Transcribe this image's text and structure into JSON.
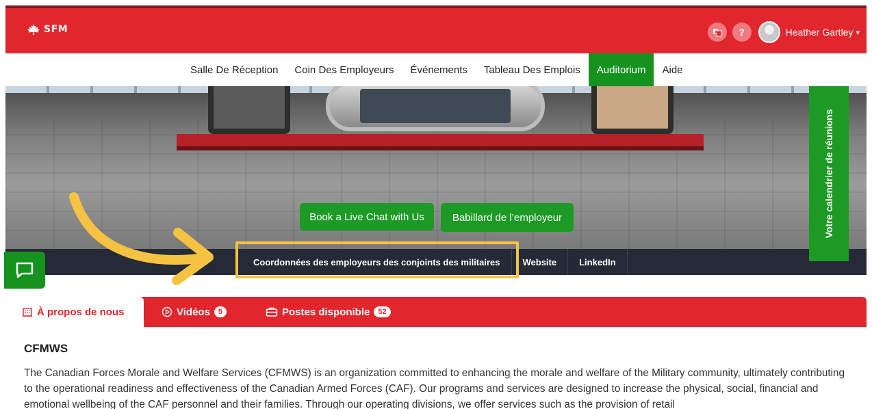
{
  "header": {
    "logo_text": "SFM",
    "translate_icon": "translate-icon",
    "help_label": "?",
    "user_name": "Heather Gartley",
    "caret": "▾",
    "brand_red": "#e1262d"
  },
  "nav": {
    "items": [
      {
        "label": "Salle De Réception"
      },
      {
        "label": "Coin Des Employeurs"
      },
      {
        "label": "Événements"
      },
      {
        "label": "Tableau Des Emplois"
      },
      {
        "label": "Auditorium",
        "active": true
      },
      {
        "label": "Aide"
      }
    ],
    "active_color": "#16921f"
  },
  "hero": {
    "book_chat_label": "Book a Live Chat with Us",
    "board_label": "Babillard de l’employeur",
    "calendar_label": "Votre calendrier de réunions"
  },
  "links_bar": {
    "items": [
      {
        "label": "Coordonnées des employeurs des conjoints des militaires"
      },
      {
        "label": "Website"
      },
      {
        "label": "LinkedIn"
      }
    ]
  },
  "annotation": {
    "highlight_color": "#f5c242"
  },
  "tabs": {
    "about": {
      "label": "À propos de nous",
      "icon": "building-icon"
    },
    "videos": {
      "label": "Vidéos",
      "count": "5",
      "icon": "play-circle-icon"
    },
    "jobs": {
      "label": "Postes disponible",
      "count": "52",
      "icon": "briefcase-icon"
    }
  },
  "content": {
    "title": "CFMWS",
    "body": "The Canadian Forces Morale and Welfare Services (CFMWS) is an organization committed to enhancing the morale and welfare of the Military community, ultimately contributing to the operational readiness and effectiveness of the Canadian Armed Forces (CAF). Our programs and services are designed to increase the physical, social, financial and emotional wellbeing of the CAF personnel and their families. Through our operating divisions, we offer services such as the provision of retail"
  }
}
